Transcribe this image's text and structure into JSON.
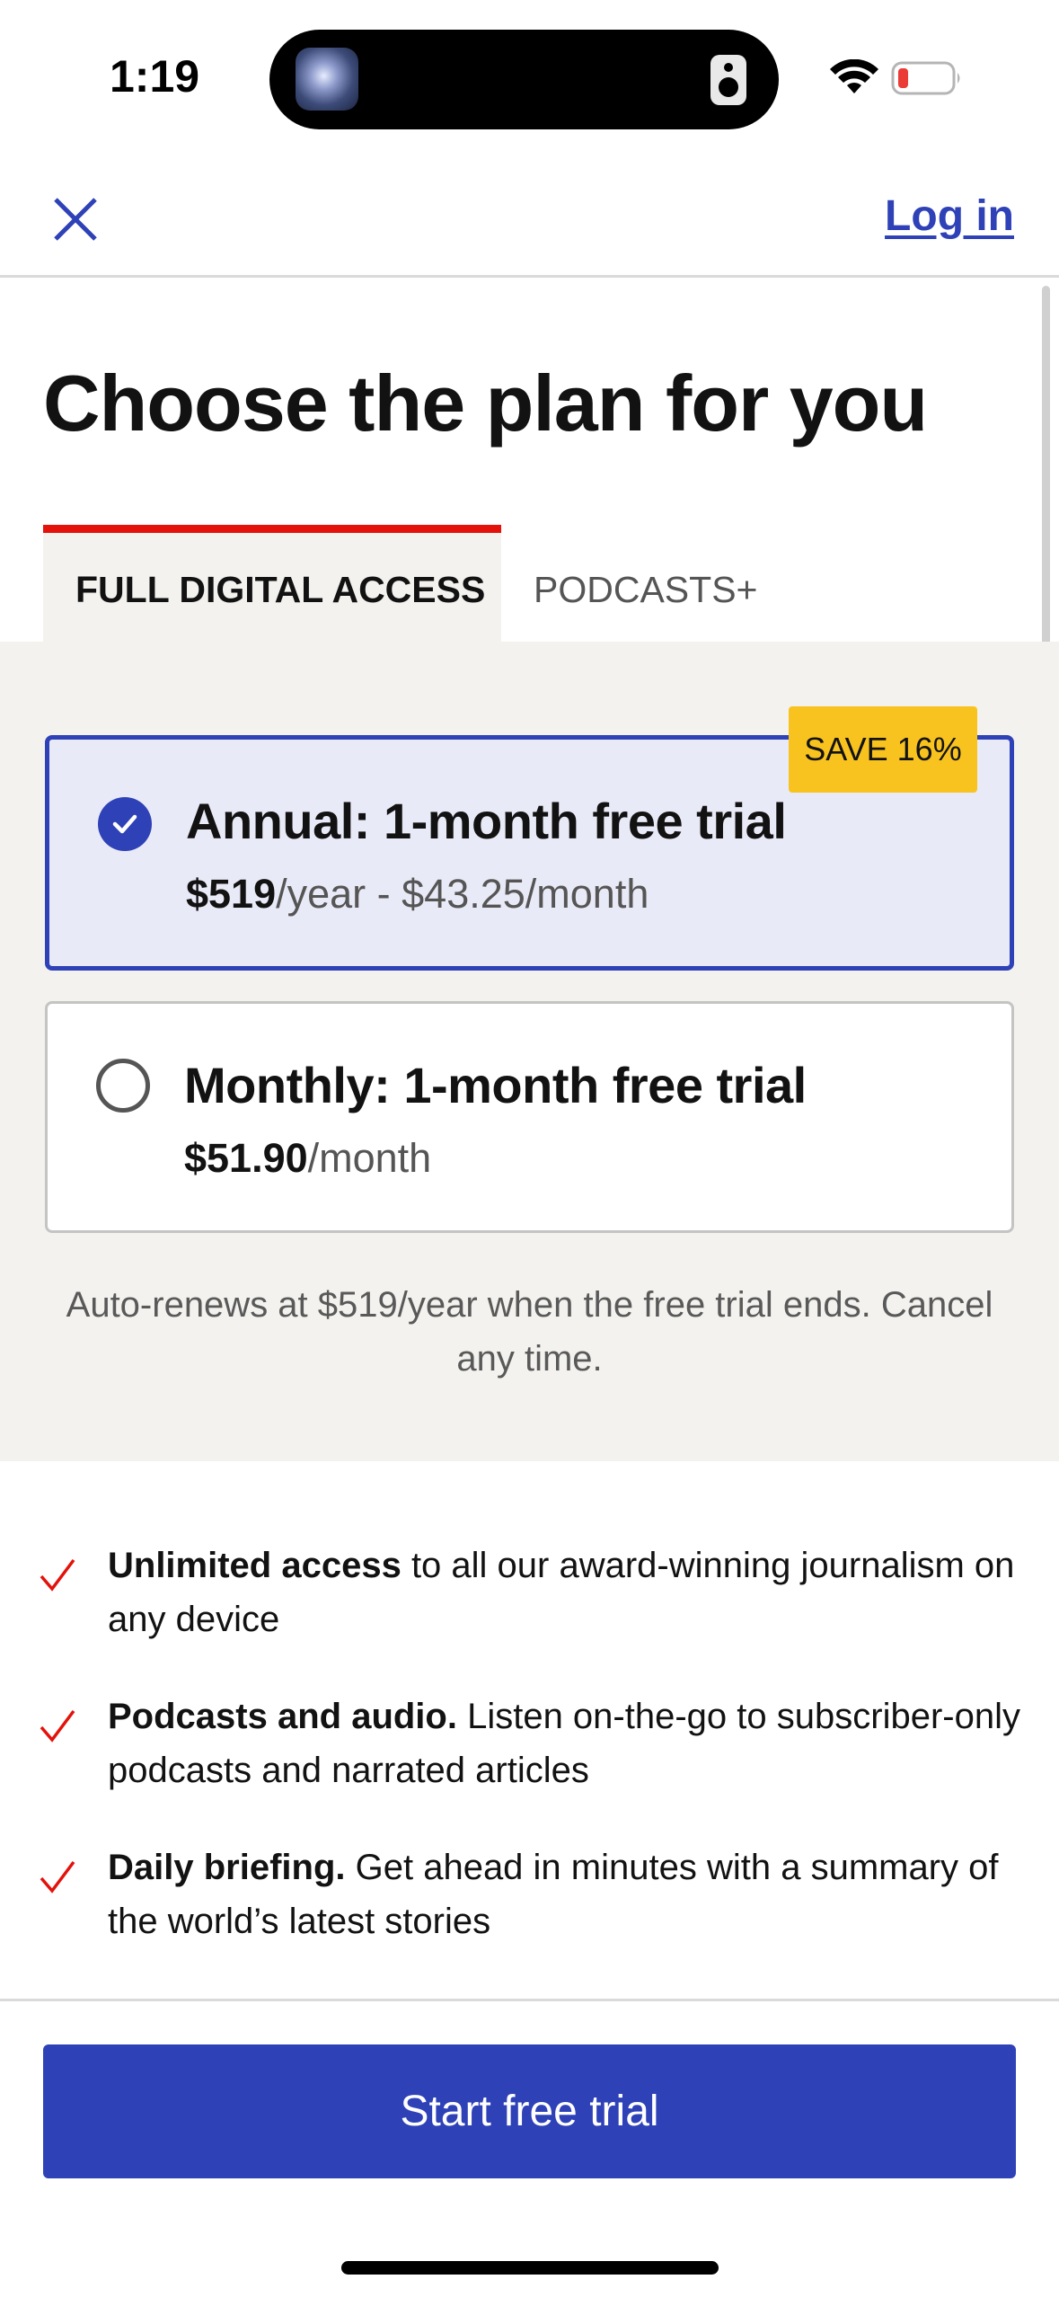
{
  "status_bar": {
    "time": "1:19",
    "icons": [
      "dynamic-island-media-thumbnail",
      "speaker-icon",
      "wifi-icon",
      "battery-low-icon"
    ]
  },
  "nav": {
    "close_icon": "close-icon",
    "login_label": "Log in"
  },
  "headline": "Choose the plan for you",
  "tabs": [
    {
      "label": "FULL DIGITAL ACCESS",
      "active": true
    },
    {
      "label": "PODCASTS+",
      "active": false
    }
  ],
  "plans": [
    {
      "title": "Annual: 1-month free trial",
      "price_strong": "$519",
      "price_rest": "/year - $43.25/month",
      "selected": true,
      "badge": "SAVE 16%"
    },
    {
      "title": "Monthly: 1-month free trial",
      "price_strong": "$51.90",
      "price_rest": "/month",
      "selected": false
    }
  ],
  "renew_note": "Auto-renews at $519/year when the free trial ends. Cancel any time.",
  "benefits": [
    {
      "strong": "Unlimited access",
      "text": " to all our award-winning journalism on any device"
    },
    {
      "strong": "Podcasts and audio.",
      "text": " Listen on-the-go to subscriber-only podcasts and narrated articles"
    },
    {
      "strong": "Daily briefing.",
      "text": " Get ahead in minutes with a summary of the world’s latest stories"
    }
  ],
  "cta_label": "Start free trial",
  "colors": {
    "accent_blue": "#2e41b7",
    "tab_red": "#e3120b",
    "badge_yellow": "#f9c31f",
    "panel_bg": "#f3f2ee",
    "check_red": "#e3120b"
  }
}
